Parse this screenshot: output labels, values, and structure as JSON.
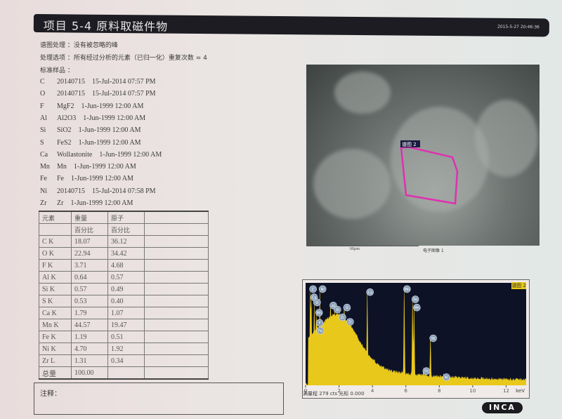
{
  "header": {
    "title": "项目 5-4   原料取磁件物",
    "datetime": "2015-5-27 20:46:36"
  },
  "info": {
    "spectrum_processing": "谱图处理 ：没有被忽略的峰",
    "processing_options": "处理选项 ：所有经过分析的元素（已归一化）重复次数 = 4",
    "standards_label": "标准样品 ："
  },
  "standards": [
    {
      "el": "C",
      "std": "20140715",
      "date": "15-Jul-2014 07:57 PM"
    },
    {
      "el": "O",
      "std": "20140715",
      "date": "15-Jul-2014 07:57 PM"
    },
    {
      "el": "F",
      "std": "MgF2",
      "date": "1-Jun-1999 12:00 AM"
    },
    {
      "el": "Al",
      "std": "Al2O3",
      "date": "1-Jun-1999 12:00 AM"
    },
    {
      "el": "Si",
      "std": "SiO2",
      "date": "1-Jun-1999 12:00 AM"
    },
    {
      "el": "S",
      "std": "FeS2",
      "date": "1-Jun-1999 12:00 AM"
    },
    {
      "el": "Ca",
      "std": "Wollastonite",
      "date": "1-Jun-1999 12:00 AM"
    },
    {
      "el": "Mn",
      "std": "Mn",
      "date": "1-Jun-1999 12:00 AM"
    },
    {
      "el": "Fe",
      "std": "Fe",
      "date": "1-Jun-1999 12:00 AM"
    },
    {
      "el": "Ni",
      "std": "20140715",
      "date": "15-Jul-2014 07:58 PM"
    },
    {
      "el": "Zr",
      "std": "Zr",
      "date": "1-Jun-1999 12:00 AM"
    }
  ],
  "table": {
    "headers": [
      "元素",
      "重量",
      "原子"
    ],
    "subheaders": [
      "",
      "百分比",
      "百分比"
    ],
    "rows": [
      [
        "C K",
        "18.07",
        "36.12"
      ],
      [
        "O K",
        "22.94",
        "34.42"
      ],
      [
        "F K",
        "3.71",
        "4.68"
      ],
      [
        "Al K",
        "0.64",
        "0.57"
      ],
      [
        "Si K",
        "0.57",
        "0.49"
      ],
      [
        "S K",
        "0.53",
        "0.40"
      ],
      [
        "Ca K",
        "1.79",
        "1.07"
      ],
      [
        "Mn K",
        "44.57",
        "19.47"
      ],
      [
        "Fe K",
        "1.19",
        "0.51"
      ],
      [
        "Ni K",
        "4.70",
        "1.92"
      ],
      [
        "Zr L",
        "1.31",
        "0.34"
      ],
      [
        "总量",
        "100.00",
        ""
      ]
    ]
  },
  "note": {
    "label": "注释："
  },
  "sem": {
    "region_label": "谱图 2",
    "scale": "60μm",
    "caption": "电子图像 1",
    "region_color": "#e030b0"
  },
  "spectrum": {
    "title": "谱图 2",
    "footer": "满量程 279 cts 光标 0.000",
    "unit": "keV",
    "ticks": [
      "0",
      "2",
      "4",
      "6",
      "8",
      "10",
      "12"
    ],
    "xmax": 13.2,
    "fill_color": "#e8c81a",
    "peaks": [
      {
        "label": "C",
        "kev": 0.28,
        "h": 0.98
      },
      {
        "label": "Ca",
        "kev": 0.34,
        "h": 0.9
      },
      {
        "label": "O",
        "kev": 0.52,
        "h": 0.85
      },
      {
        "label": "Mn",
        "kev": 0.64,
        "h": 0.75
      },
      {
        "label": "F",
        "kev": 0.68,
        "h": 0.65
      },
      {
        "label": "Fe",
        "kev": 0.71,
        "h": 0.6
      },
      {
        "label": "Ni",
        "kev": 0.85,
        "h": 0.98
      },
      {
        "label": "Al",
        "kev": 1.49,
        "h": 0.82
      },
      {
        "label": "Si",
        "kev": 1.74,
        "h": 0.78
      },
      {
        "label": "Zr",
        "kev": 2.04,
        "h": 0.72
      },
      {
        "label": "S",
        "kev": 2.31,
        "h": 0.8
      },
      {
        "label": "Zr",
        "kev": 2.5,
        "h": 0.66
      },
      {
        "label": "Ca",
        "kev": 3.69,
        "h": 0.95
      },
      {
        "label": "Mn",
        "kev": 5.9,
        "h": 0.98
      },
      {
        "label": "Fe",
        "kev": 6.4,
        "h": 0.88
      },
      {
        "label": "Mn",
        "kev": 6.49,
        "h": 0.8
      },
      {
        "label": "Fe",
        "kev": 7.06,
        "h": 0.18
      },
      {
        "label": "Ni",
        "kev": 7.47,
        "h": 0.5
      },
      {
        "label": "Ni",
        "kev": 8.26,
        "h": 0.12
      }
    ]
  },
  "logo": {
    "text": "INCA"
  }
}
